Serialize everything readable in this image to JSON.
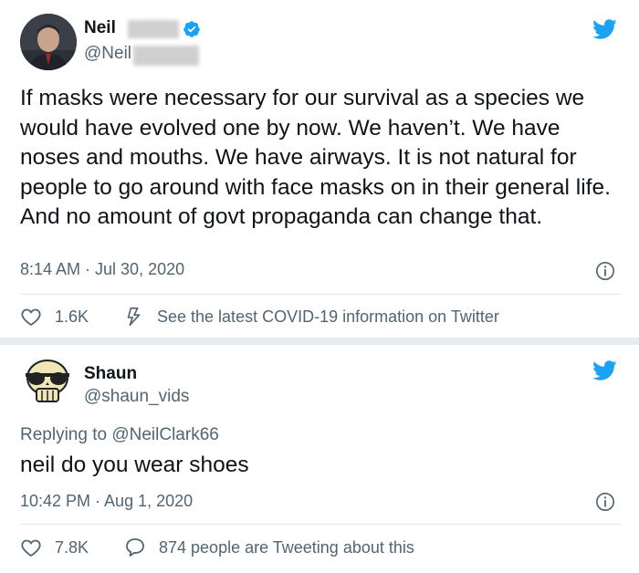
{
  "tweet1": {
    "name": "Neil",
    "handle": "@Neil",
    "text": "If masks were necessary for our survival as a species we would have evolved one by now. We haven’t. We have noses and mouths. We have airways. It is not natural for people to go around with face masks on in their general life. And no amount of govt propaganda can change that.",
    "timestamp": "8:14 AM · Jul 30, 2020",
    "likes": "1.6K",
    "info_link": "See the latest COVID-19 information on Twitter"
  },
  "tweet2": {
    "name": "Shaun",
    "handle": "@shaun_vids",
    "replying_prefix": "Replying to",
    "replying_to": "@NeilClark66",
    "text": "neil do you wear shoes",
    "timestamp": "10:42 PM · Aug 1, 2020",
    "likes": "7.8K",
    "tweeting_about": "874 people are Tweeting about this"
  },
  "icons": {
    "brand": "twitter-bird-icon",
    "verified": "verified-badge-icon",
    "info": "info-icon",
    "like": "heart-icon",
    "covid": "lightning-icon",
    "reply": "speech-bubble-icon"
  },
  "colors": {
    "twitter_blue": "#1da1f2",
    "text": "#0f1419",
    "secondary": "#536471"
  }
}
